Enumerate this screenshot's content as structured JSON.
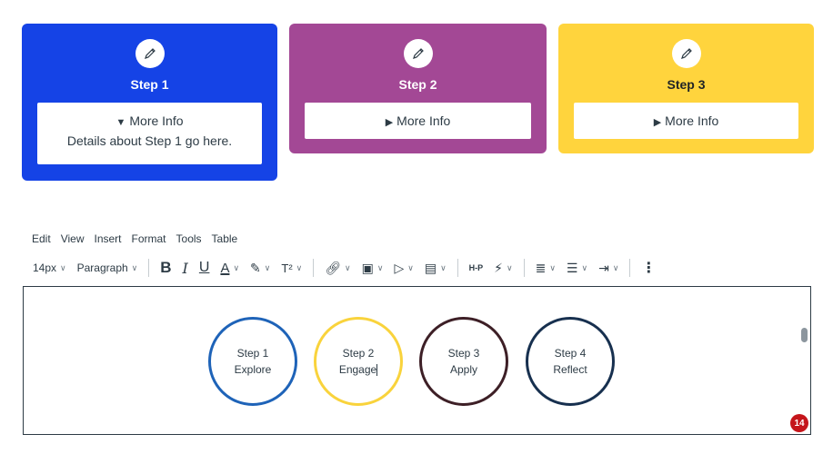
{
  "steps": [
    {
      "title": "Step 1",
      "toggle": "More Info",
      "expanded": true,
      "details": "Details about Step 1 go here.",
      "color": "#1543e6"
    },
    {
      "title": "Step 2",
      "toggle": "More Info",
      "expanded": false,
      "color": "#a34895"
    },
    {
      "title": "Step 3",
      "toggle": "More Info",
      "expanded": false,
      "color": "#ffd43d"
    }
  ],
  "menubar": [
    "Edit",
    "View",
    "Insert",
    "Format",
    "Tools",
    "Table"
  ],
  "toolbar": {
    "font_size": "14px",
    "block_format": "Paragraph",
    "bold": "B",
    "italic": "I",
    "underline": "U",
    "text_color": "A",
    "superscript": "T²",
    "h5p": "H-P"
  },
  "editor": {
    "circles": [
      {
        "line1": "Step 1",
        "line2": "Explore",
        "border": "#1e63b8"
      },
      {
        "line1": "Step 2",
        "line2": "Engage",
        "border": "#f9d33c"
      },
      {
        "line1": "Step 3",
        "line2": "Apply",
        "border": "#3d1f26"
      },
      {
        "line1": "Step 4",
        "line2": "Reflect",
        "border": "#17304f"
      }
    ],
    "badge_count": "14"
  }
}
